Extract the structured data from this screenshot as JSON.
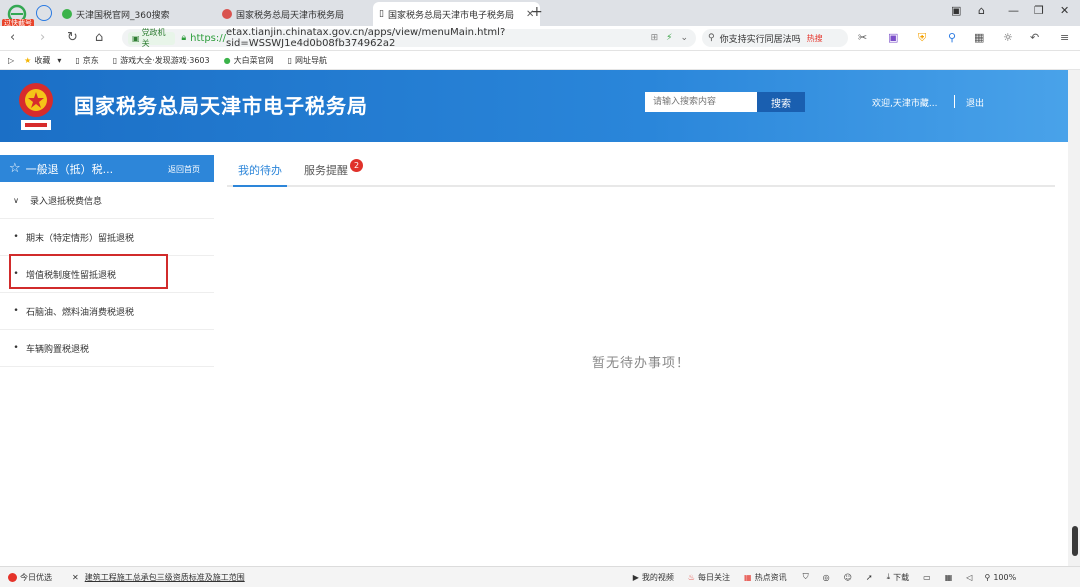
{
  "browser": {
    "badge": "过快截号",
    "tabs": [
      {
        "label": "天津国税官网_360搜索"
      },
      {
        "label": "国家税务总局天津市税务局"
      },
      {
        "label": "国家税务总局天津市电子税务局"
      }
    ],
    "address": {
      "gov_badge": "党政机关",
      "url_scheme": "https://",
      "url_rest": "etax.tianjin.chinatax.gov.cn/apps/view/menuMain.html?sid=WSSWJ1e4d0b08fb374962a2"
    },
    "search": {
      "text": "你支持实行同居法吗",
      "hot": "热搜"
    },
    "bookmarks": [
      {
        "label": "收藏"
      },
      {
        "label": "京东"
      },
      {
        "label": "游戏大全·发现游戏·3603"
      },
      {
        "label": "大白菜官网"
      },
      {
        "label": "网址导航"
      }
    ]
  },
  "header": {
    "title": "国家税务总局天津市电子税务局",
    "search_placeholder": "请输入搜索内容",
    "search_button": "搜索",
    "welcome": "欢迎,天津市藏...",
    "logout": "退出"
  },
  "sidebar": {
    "title": "一般退（抵）税...",
    "home": "返回首页",
    "items": [
      {
        "label": "录入退抵税费信息",
        "marker": "∨"
      },
      {
        "label": "期末（特定情形）留抵退税",
        "marker": "•"
      },
      {
        "label": "增值税制度性留抵退税",
        "marker": "•"
      },
      {
        "label": "石脑油、燃料油消费税退税",
        "marker": "•"
      },
      {
        "label": "车辆购置税退税",
        "marker": "•"
      }
    ]
  },
  "main": {
    "tabs": [
      {
        "label": "我的待办"
      },
      {
        "label": "服务提醒",
        "badge": "2"
      }
    ],
    "empty_text": "暂无待办事项！"
  },
  "statusbar": {
    "left1": "今日优选",
    "news": "建筑工程施工总承包三级资质标准及施工范围",
    "video": "我的视频",
    "daily": "每日关注",
    "hotnews": "热点资讯",
    "download": "下载",
    "zoom": "100%"
  },
  "colors": {
    "header_blue": "#2a86da",
    "accent": "#2d86d9",
    "highlight_red": "#d12b2b",
    "badge_red": "#e0312a"
  }
}
